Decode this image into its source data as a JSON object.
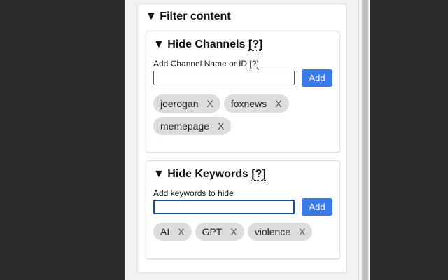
{
  "filter": {
    "title": "Filter content",
    "channels": {
      "title": "Hide Channels",
      "help": "[?]",
      "label": "Add Channel Name or ID",
      "label_help": "[?]",
      "value": "",
      "add": "Add",
      "items": [
        "joerogan",
        "foxnews",
        "memepage"
      ]
    },
    "keywords": {
      "title": "Hide Keywords",
      "help": "[?]",
      "label": "Add keywords to hide",
      "value": "",
      "add": "Add",
      "items": [
        "AI",
        "GPT",
        "violence"
      ]
    },
    "toggle": "▼",
    "remove": "X"
  }
}
